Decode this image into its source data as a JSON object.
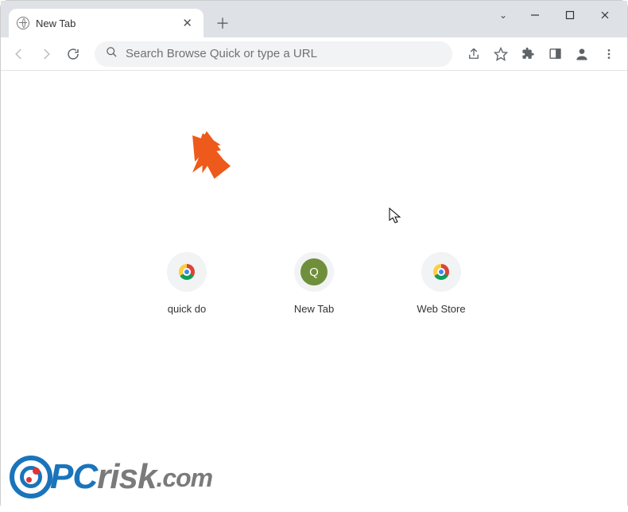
{
  "tab": {
    "title": "New Tab"
  },
  "omnibox": {
    "placeholder": "Search Browse Quick or type a URL"
  },
  "shortcuts": [
    {
      "label": "quick do",
      "kind": "chrome"
    },
    {
      "label": "New Tab",
      "kind": "q"
    },
    {
      "label": "Web Store",
      "kind": "chrome"
    }
  ],
  "watermark": {
    "text": "PCrisk.com"
  }
}
